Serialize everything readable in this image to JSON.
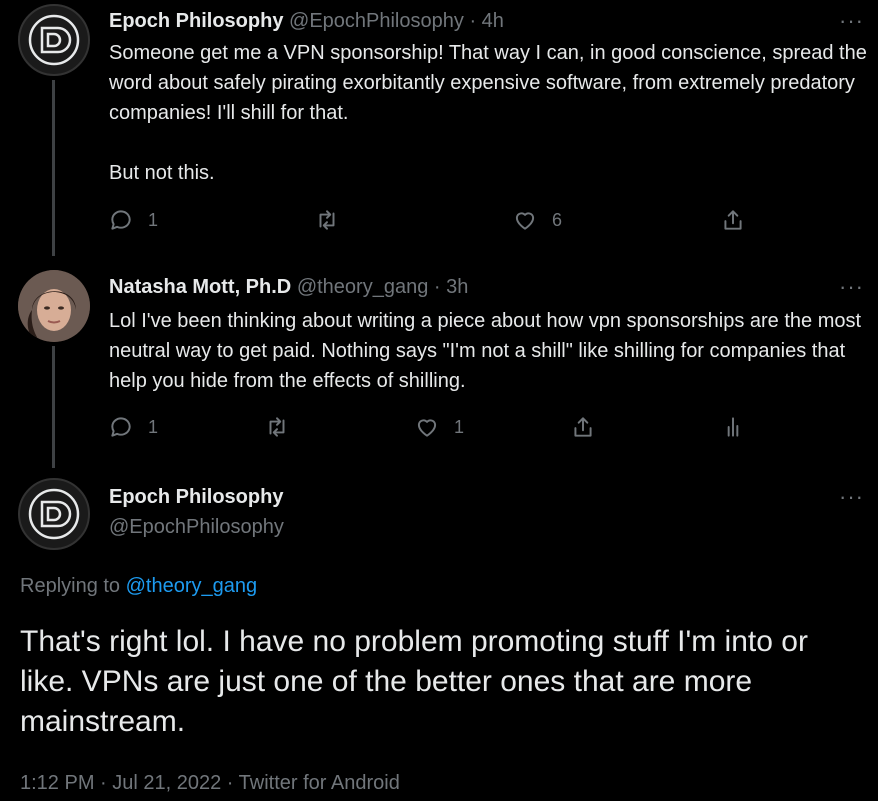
{
  "tweet1": {
    "name": "Epoch Philosophy",
    "handle": "@EpochPhilosophy",
    "time": "· 4h",
    "text": "Someone get me a VPN sponsorship! That way I can, in good conscience, spread the word about safely pirating exorbitantly expensive software, from extremely predatory companies! I'll shill for that.\n\nBut not this.",
    "replies": "1",
    "retweets": "",
    "likes": "6"
  },
  "tweet2": {
    "name": "Natasha Mott, Ph.D",
    "handle": "@theory_gang",
    "time": "· 3h",
    "text": "Lol I've been thinking about writing a piece about how vpn sponsorships are the most neutral way to get paid. Nothing says \"I'm not a shill\" like shilling for companies that help you hide from the effects of shilling.",
    "replies": "1",
    "retweets": "",
    "likes": "1"
  },
  "main_tweet": {
    "name": "Epoch Philosophy",
    "handle": "@EpochPhilosophy",
    "replying_prefix": "Replying to",
    "replying_handle": "@theory_gang",
    "text": "That's right lol. I have no problem promoting stuff I'm into or like. VPNs are just one of the better ones that are more mainstream.",
    "timestamp": "1:12 PM · Jul 21, 2022 · Twitter for Android"
  },
  "icons": {
    "more": "···",
    "reply": "reply-icon",
    "retweet": "retweet-icon",
    "like": "heart-icon",
    "share": "share-icon",
    "analytics": "analytics-icon"
  },
  "colors": {
    "background": "#000000",
    "text": "#e7e9ea",
    "muted": "#71767b",
    "link": "#1d9bf0"
  }
}
